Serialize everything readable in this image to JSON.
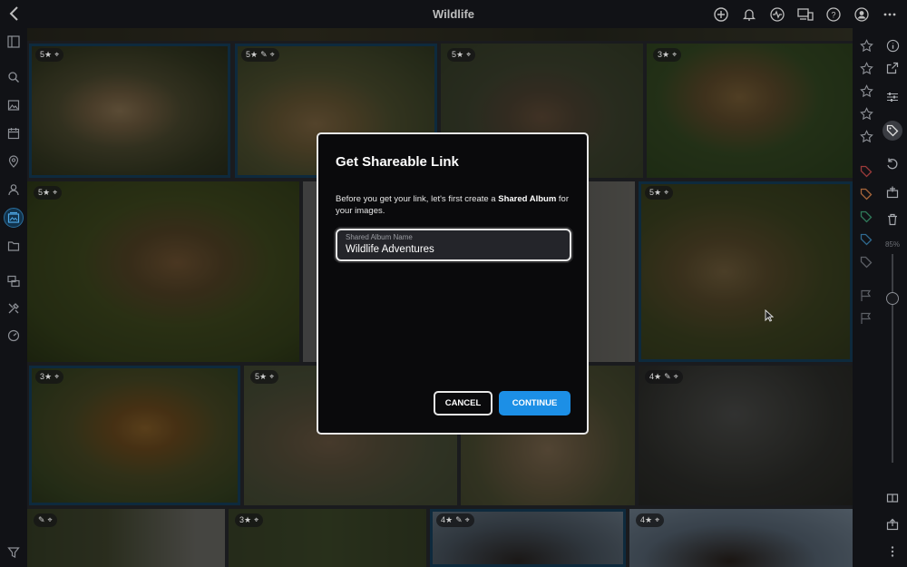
{
  "window": {
    "title": "Wildlife"
  },
  "top_icons": [
    "add-icon",
    "bell-icon",
    "activity-icon",
    "devices-icon",
    "help-icon",
    "account-icon",
    "more-icon"
  ],
  "left_sidebar": [
    "panel-toggle-icon",
    "search-icon",
    "photos-icon",
    "calendar-icon",
    "location-icon",
    "people-icon",
    "albums-icon",
    "folder-icon",
    "duplicates-icon",
    "tools-icon",
    "dashboard-icon",
    "filter-icon"
  ],
  "right_sidebar": {
    "zoom_label": "85%"
  },
  "photos": [
    {
      "badge": "5★",
      "extra": "pin"
    },
    {
      "badge": "5★",
      "extra": "edit-pin"
    },
    {
      "badge": "5★",
      "extra": "pin"
    },
    {
      "badge": "3★",
      "extra": "pin"
    },
    {
      "badge": "5★",
      "extra": "pin"
    },
    {
      "badge": "5★",
      "extra": "pin"
    },
    {
      "badge": "3★",
      "extra": "pin"
    },
    {
      "badge": "5★",
      "extra": "pin"
    },
    {
      "badge": "4★",
      "extra": "edit-pin"
    },
    {
      "badge": "",
      "extra": "edit-pin"
    },
    {
      "badge": "3★",
      "extra": "pin"
    },
    {
      "badge": "4★",
      "extra": "edit-pin"
    },
    {
      "badge": "4★",
      "extra": "pin"
    }
  ],
  "dialog": {
    "title": "Get Shareable Link",
    "text_before": "Before you get your link, let's first create a ",
    "text_bold": "Shared Album",
    "text_after": " for your images.",
    "field_label": "Shared Album Name",
    "field_value": "Wildlife Adventures",
    "cancel_label": "CANCEL",
    "continue_label": "CONTINUE"
  },
  "colors": {
    "accent": "#1c8fe6",
    "selection": "#1f5e87",
    "background": "#0c0d10"
  }
}
